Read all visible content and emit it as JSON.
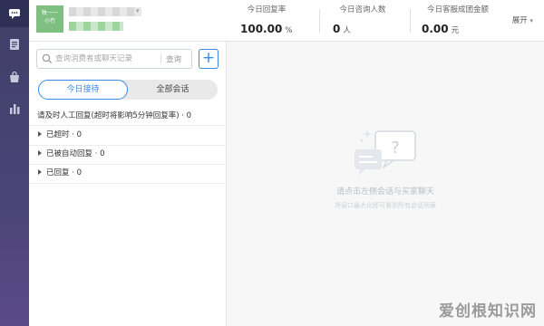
{
  "rail": {
    "items": [
      {
        "icon": "chat-bubble-icon"
      },
      {
        "icon": "document-icon"
      },
      {
        "icon": "bag-icon"
      },
      {
        "icon": "bar-chart-icon"
      }
    ]
  },
  "header": {
    "shop_logo_text": "牧一一\n小冇",
    "stats": [
      {
        "label": "今日回复率",
        "value": "100.00",
        "unit": "%"
      },
      {
        "label": "今日咨询人数",
        "value": "0",
        "unit": "人"
      },
      {
        "label": "今日客服成团金额",
        "value": "0.00",
        "unit": "元"
      }
    ],
    "expand_label": "展开",
    "expand_caret": "▾"
  },
  "search": {
    "placeholder": "查询消费者或聊天记录",
    "button_label": "查询",
    "add_label": "+"
  },
  "tabs": [
    {
      "label": "今日接待",
      "active": true
    },
    {
      "label": "全部会话",
      "active": false
    }
  ],
  "groups": {
    "header": "请及时人工回复(超时将影响5分钟回复率) · 0",
    "rows": [
      {
        "label": "已超时 · 0"
      },
      {
        "label": "已被自动回复 · 0"
      },
      {
        "label": "已回复 · 0"
      }
    ]
  },
  "empty_state": {
    "title": "请点击左侧会话与买家聊天",
    "subtitle": "将窗口最大化即可看到所有会话列表"
  },
  "watermark": "爱创根知识网",
  "colors": {
    "accent": "#3a8be8",
    "rail": "#45446f"
  }
}
